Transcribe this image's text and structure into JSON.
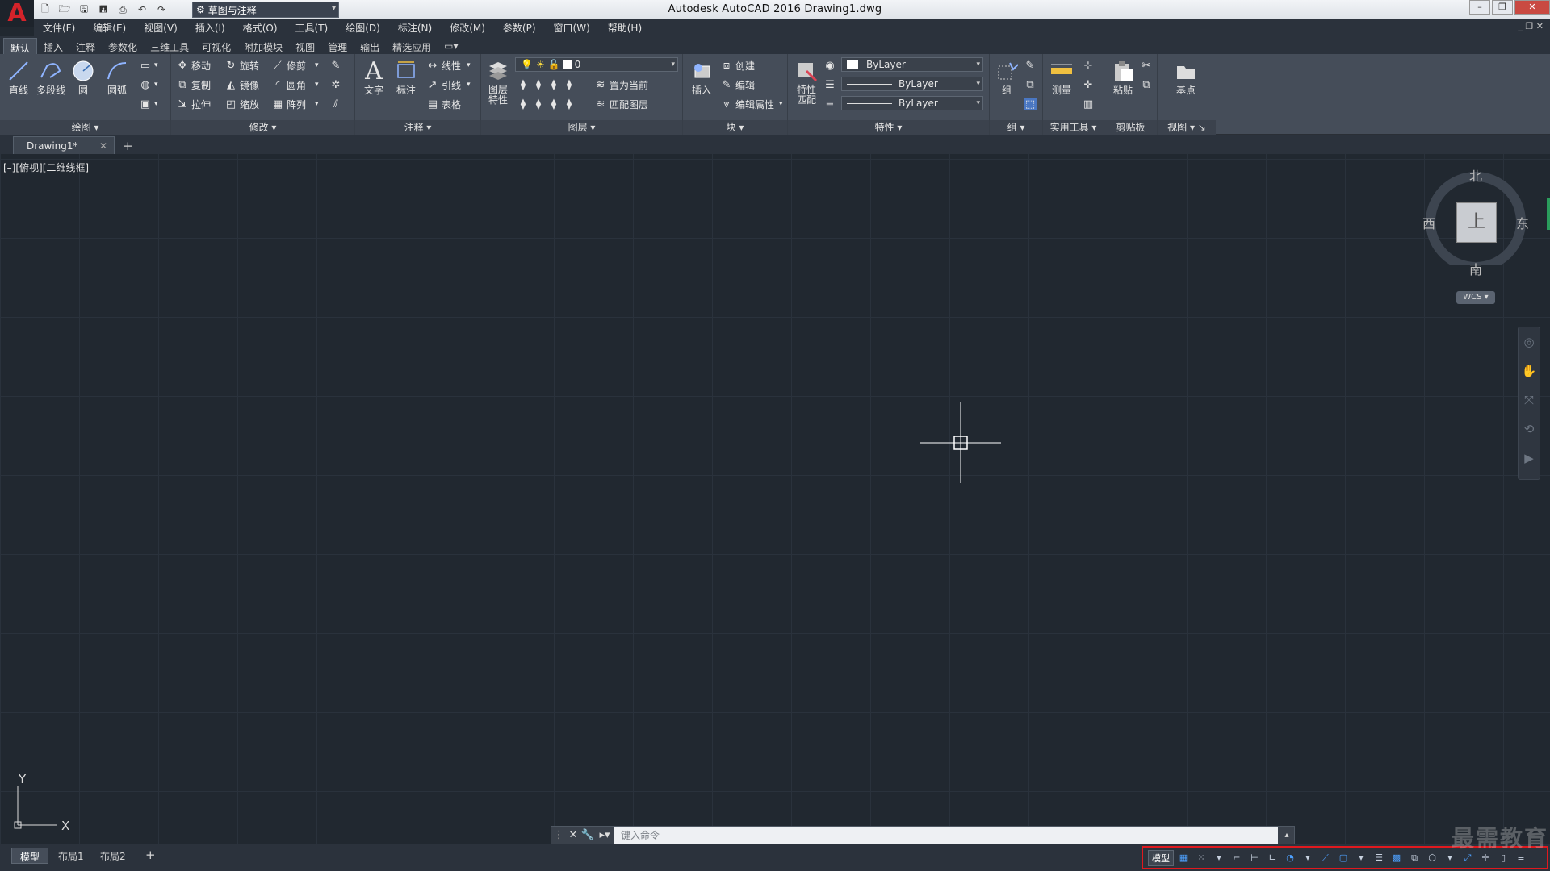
{
  "titlebar": {
    "app_logo": "A",
    "workspace": "草图与注释",
    "title": "Autodesk AutoCAD 2016    Drawing1.dwg",
    "minimize": "–",
    "restore": "❐",
    "close": "✕"
  },
  "menubar": {
    "items": [
      "文件(F)",
      "编辑(E)",
      "视图(V)",
      "插入(I)",
      "格式(O)",
      "工具(T)",
      "绘图(D)",
      "标注(N)",
      "修改(M)",
      "参数(P)",
      "窗口(W)",
      "帮助(H)"
    ],
    "doc_controls": "_ ❐ ✕"
  },
  "ribbon_tabs": [
    "默认",
    "插入",
    "注释",
    "参数化",
    "三维工具",
    "可视化",
    "附加模块",
    "视图",
    "管理",
    "输出",
    "精选应用"
  ],
  "ribbon": {
    "draw": {
      "title": "绘图",
      "line": "直线",
      "polyline": "多段线",
      "circle": "圆",
      "arc": "圆弧"
    },
    "modify": {
      "title": "修改",
      "move": "移动",
      "rotate": "旋转",
      "trim": "修剪",
      "copy": "复制",
      "mirror": "镜像",
      "fillet": "圆角",
      "stretch": "拉伸",
      "scale": "缩放",
      "array": "阵列"
    },
    "annotation": {
      "title": "注释",
      "text": "文字",
      "dimension": "标注",
      "linear": "线性",
      "leader": "引线",
      "table": "表格"
    },
    "layers": {
      "title": "图层",
      "layer_props": "图层\n特性",
      "layer_name": "0",
      "set_current": "置为当前",
      "match_layer": "匹配图层"
    },
    "block": {
      "title": "块",
      "insert": "插入",
      "create": "创建",
      "edit": "编辑",
      "edit_attr": "编辑属性"
    },
    "properties": {
      "title": "特性",
      "match": "特性\n匹配",
      "color": "ByLayer",
      "linetype": "ByLayer",
      "lineweight": "ByLayer"
    },
    "groups": {
      "title": "组",
      "group": "组"
    },
    "utilities": {
      "title": "实用工具",
      "measure": "测量"
    },
    "clipboard": {
      "title": "剪贴板",
      "paste": "粘贴"
    },
    "view": {
      "title": "视图",
      "base": "基点"
    }
  },
  "doc_tab": {
    "name": "Drawing1*",
    "close": "✕",
    "new": "+"
  },
  "canvas": {
    "view_label": "[–][俯视][二维线框]",
    "viewcube": {
      "north": "北",
      "south": "南",
      "east": "东",
      "west": "西",
      "top": "上",
      "wcs": "WCS"
    },
    "ucs": {
      "x": "X",
      "y": "Y"
    }
  },
  "command": {
    "placeholder": "键入命令"
  },
  "layout_tabs": [
    "模型",
    "布局1",
    "布局2"
  ],
  "status": {
    "model": "模型"
  },
  "watermark": "最需教育",
  "colors": {
    "background": "#212830",
    "ribbon": "#454d59",
    "accent_red": "#e0191e",
    "status_blue": "#4ea1ff"
  }
}
